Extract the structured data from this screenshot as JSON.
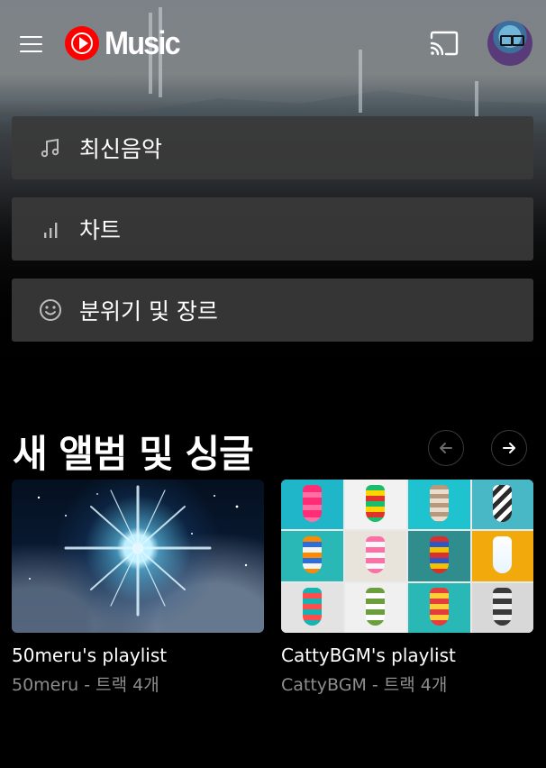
{
  "header": {
    "logo_text": "Music",
    "menu_icon": "hamburger-menu-icon",
    "cast_icon": "cast-icon",
    "avatar_icon": "avatar"
  },
  "nav": [
    {
      "label": "최신음악",
      "icon": "music-note-icon"
    },
    {
      "label": "차트",
      "icon": "chart-bars-icon"
    },
    {
      "label": "분위기 및 장르",
      "icon": "smiley-icon"
    }
  ],
  "section": {
    "title": "새 앨범 및 싱글",
    "prev_icon": "arrow-left-icon",
    "next_icon": "arrow-right-icon"
  },
  "cards": [
    {
      "title": "50meru's playlist",
      "subtitle": "50meru - 트랙 4개"
    },
    {
      "title": "CattyBGM's playlist",
      "subtitle": "CattyBGM - 트랙 4개"
    }
  ],
  "colors": {
    "brand_red": "#ff0000",
    "nav_bg": "#3a3a3a",
    "subtitle_gray": "#8d8d8d"
  }
}
